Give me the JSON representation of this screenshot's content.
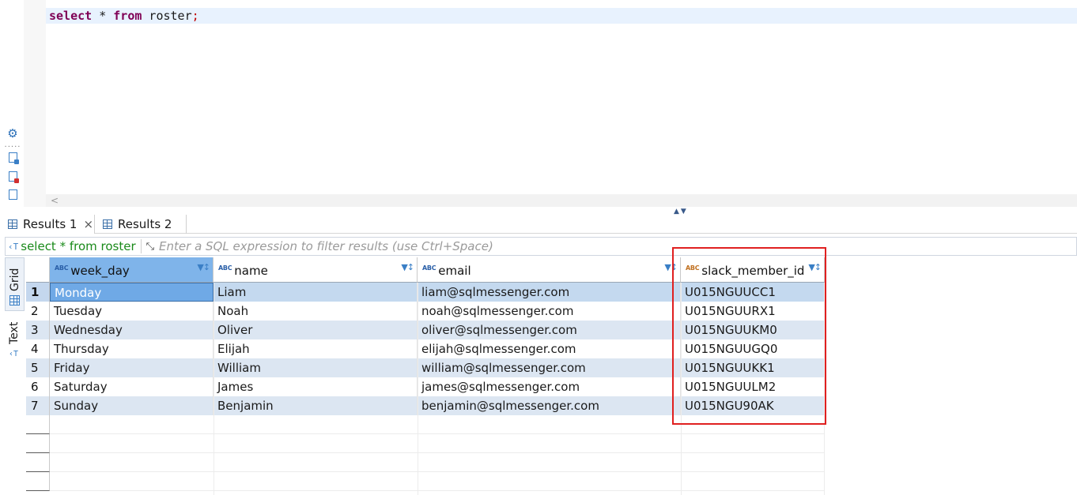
{
  "editor": {
    "sql_keyword_select": "select",
    "sql_star": " * ",
    "sql_keyword_from": "from",
    "sql_table": " roster",
    "sql_semicolon": ";"
  },
  "results_tabs": [
    {
      "label": "Results 1",
      "close": "×"
    },
    {
      "label": "Results 2"
    }
  ],
  "filter": {
    "query_icon": "‹T",
    "query": "select * from roster",
    "placeholder": "Enter a SQL expression to filter results (use Ctrl+Space)"
  },
  "side_tabs": {
    "grid": "Grid",
    "text": "Text"
  },
  "grid": {
    "columns": [
      {
        "name": "week_day",
        "type_icon": "ABC"
      },
      {
        "name": "name",
        "type_icon": "ABC"
      },
      {
        "name": "email",
        "type_icon": "ABC"
      },
      {
        "name": "slack_member_id",
        "type_icon": "ABC"
      }
    ],
    "rows": [
      {
        "n": "1",
        "week_day": "Monday",
        "name": "Liam",
        "email": "liam@sqlmessenger.com",
        "slack_member_id": "U015NGUUCC1"
      },
      {
        "n": "2",
        "week_day": "Tuesday",
        "name": "Noah",
        "email": "noah@sqlmessenger.com",
        "slack_member_id": "U015NGUURX1"
      },
      {
        "n": "3",
        "week_day": "Wednesday",
        "name": "Oliver",
        "email": "oliver@sqlmessenger.com",
        "slack_member_id": "U015NGUUKM0"
      },
      {
        "n": "4",
        "week_day": "Thursday",
        "name": "Elijah",
        "email": "elijah@sqlmessenger.com",
        "slack_member_id": "U015NGUUGQ0"
      },
      {
        "n": "5",
        "week_day": "Friday",
        "name": "William",
        "email": "william@sqlmessenger.com",
        "slack_member_id": "U015NGUUKK1"
      },
      {
        "n": "6",
        "week_day": "Saturday",
        "name": "James",
        "email": "james@sqlmessenger.com",
        "slack_member_id": "U015NGUULM2"
      },
      {
        "n": "7",
        "week_day": "Sunday",
        "name": "Benjamin",
        "email": "benjamin@sqlmessenger.com",
        "slack_member_id": "U015NGU90AK"
      }
    ]
  },
  "colors": {
    "highlight_box": "#e02020",
    "selected_header": "#7fb4ea",
    "stripe": "#dce6f2",
    "keyword": "#7f0055"
  }
}
